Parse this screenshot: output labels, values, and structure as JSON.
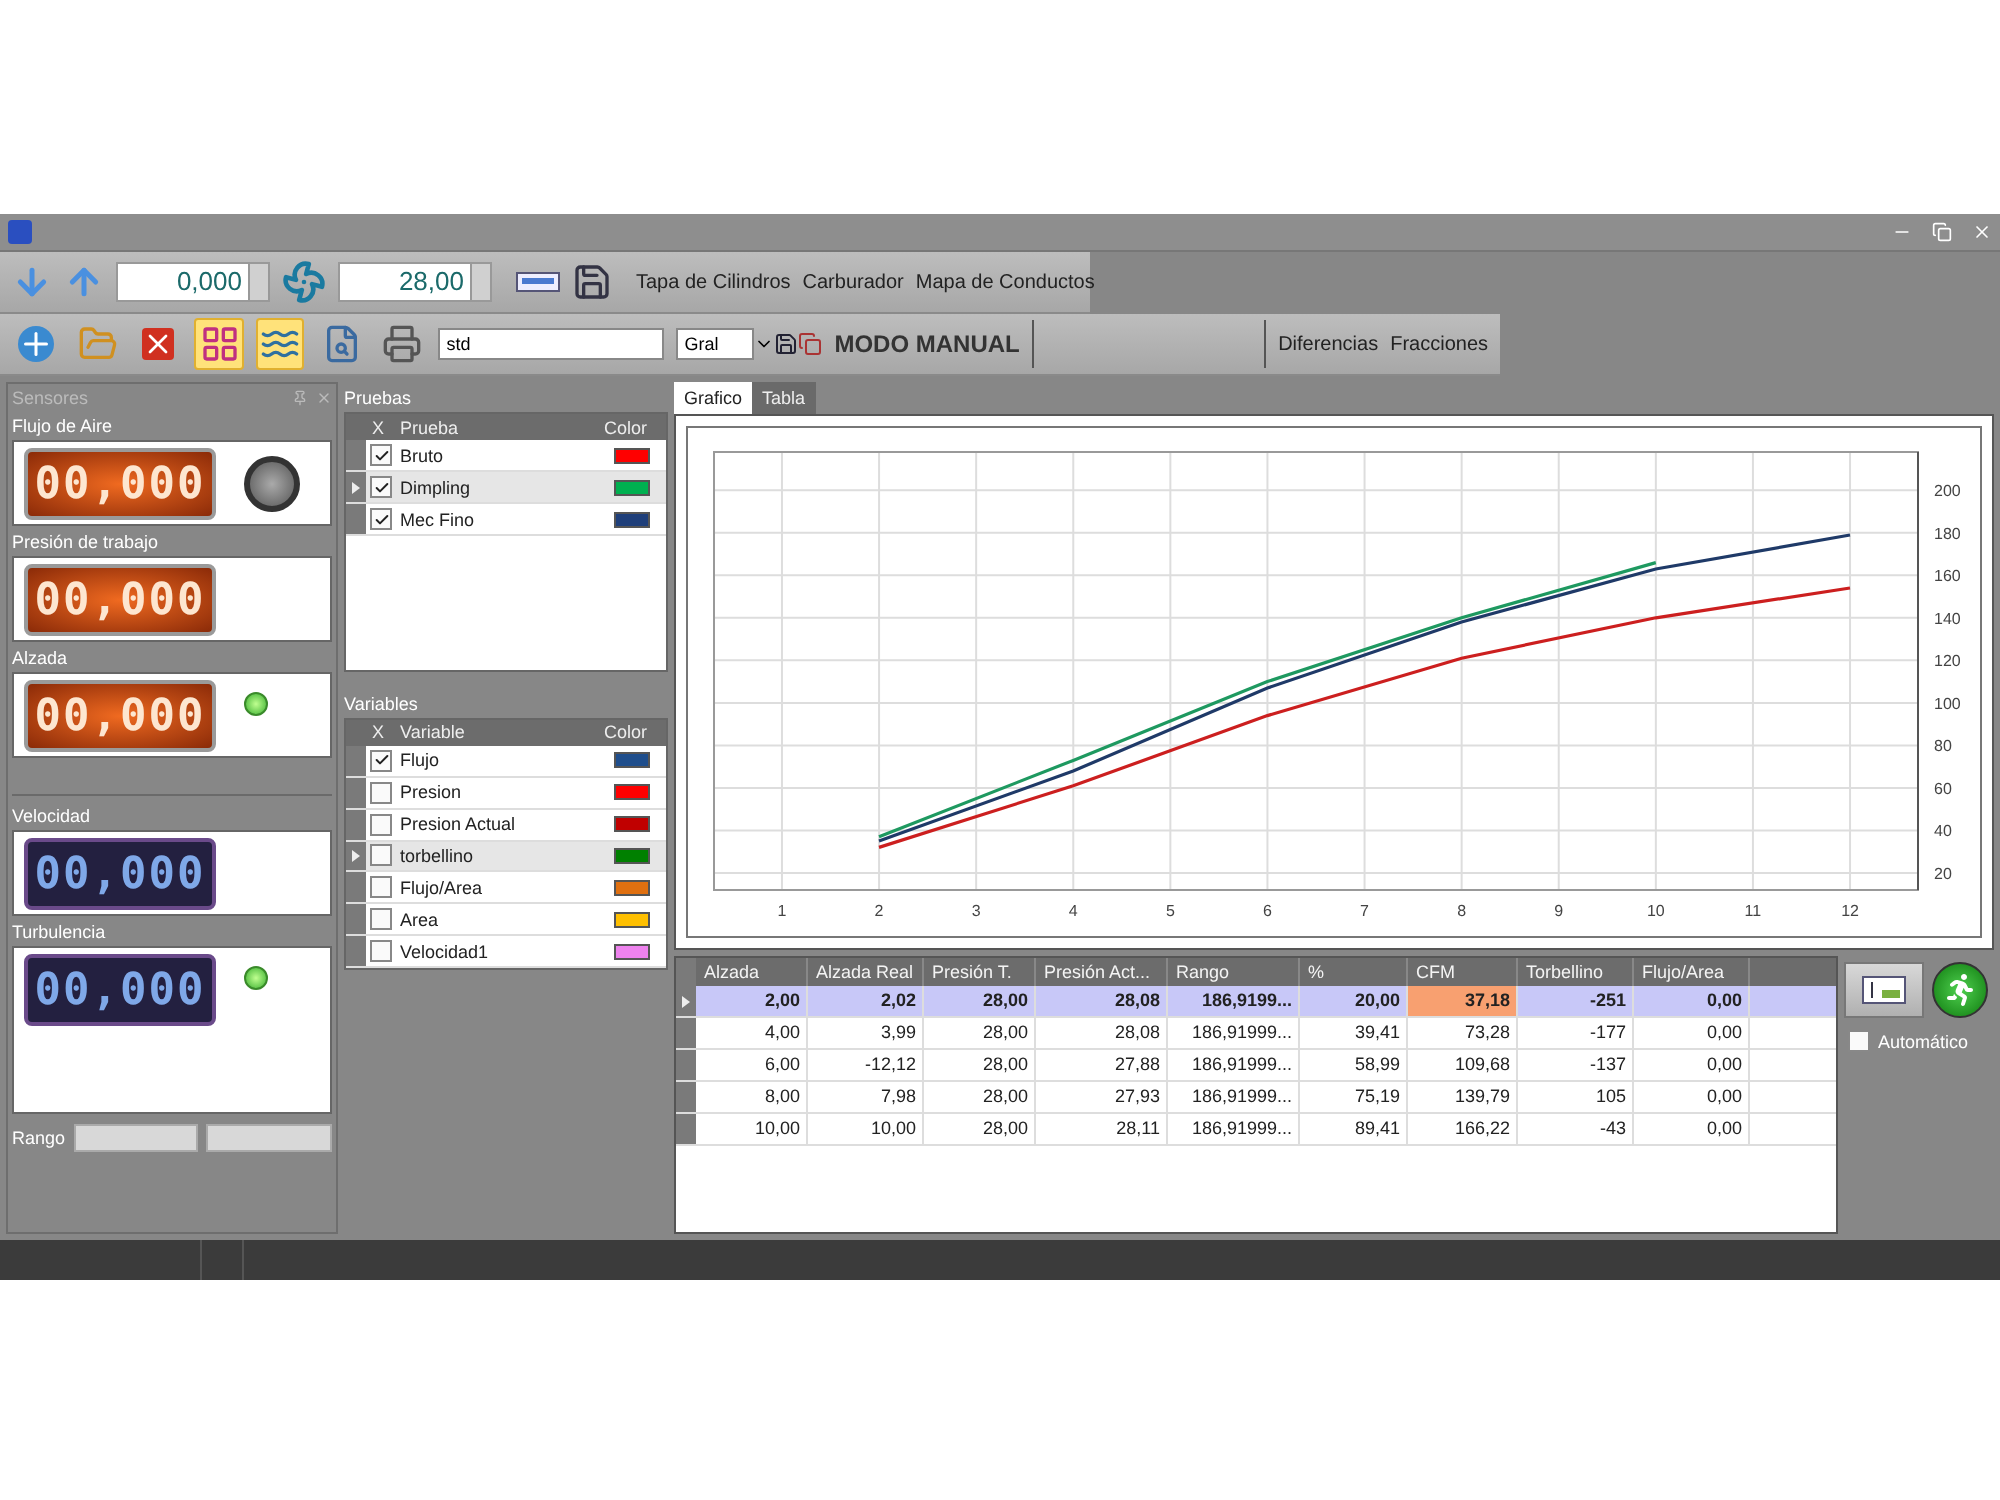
{
  "toolbar_top": {
    "fields": [
      {
        "value": "0,000"
      },
      {
        "value": "28,00"
      }
    ],
    "links": [
      "Tapa de Cilindros",
      "Carburador",
      "Mapa de Conductos"
    ]
  },
  "toolbar_main": {
    "view_buttons": [
      {
        "kind": "grid",
        "selected": true
      },
      {
        "kind": "lines",
        "selected": true
      }
    ],
    "name_field": {
      "value": "std"
    },
    "combo": {
      "value": "Gral"
    },
    "mode_label": "MODO MANUAL",
    "links": [
      "Diferencias",
      "Fracciones"
    ]
  },
  "sensors": {
    "title": "Sensores",
    "range_label": "Rango",
    "items": [
      {
        "label": "Flujo de Aire",
        "reading": "00,000",
        "kind": "orange",
        "light_on": false
      },
      {
        "label": "Presión de trabajo",
        "reading": "00,000",
        "kind": "orange"
      },
      {
        "label": "Alzada",
        "reading": "00,000",
        "kind": "orange",
        "light_on": true
      },
      {
        "label": "Velocidad",
        "reading": "00,000",
        "kind": "blue"
      },
      {
        "label": "Turbulencia",
        "reading": "00,000",
        "kind": "blue",
        "light_on": true
      }
    ]
  },
  "pruebas": {
    "title": "Pruebas",
    "columns": [
      "X",
      "Prueba",
      "Color"
    ],
    "rows": [
      {
        "name": "Bruto",
        "checked": true,
        "selected": false,
        "color": "#ff0000"
      },
      {
        "name": "Dimpling",
        "checked": true,
        "selected": true,
        "color": "#00b050"
      },
      {
        "name": "Mec Fino",
        "checked": true,
        "selected": false,
        "color": "#1f3f7a"
      }
    ]
  },
  "variables": {
    "title": "Variables",
    "columns": [
      "X",
      "Variable",
      "Color"
    ],
    "rows": [
      {
        "name": "Flujo",
        "checked": true,
        "selected": false,
        "color": "#1f4e8c"
      },
      {
        "name": "Presion",
        "checked": false,
        "selected": false,
        "color": "#ff0000"
      },
      {
        "name": "Presion Actual",
        "checked": false,
        "selected": false,
        "color": "#c00000"
      },
      {
        "name": "torbellino",
        "checked": false,
        "selected": true,
        "color": "#008000"
      },
      {
        "name": "Flujo/Area",
        "checked": false,
        "selected": false,
        "color": "#e07010"
      },
      {
        "name": "Area",
        "checked": false,
        "selected": false,
        "color": "#ffc000"
      },
      {
        "name": "Velocidad1",
        "checked": false,
        "selected": false,
        "color": "#ee82ee"
      }
    ]
  },
  "tabs": [
    {
      "label": "Grafico",
      "selected": true
    },
    {
      "label": "Tabla",
      "selected": false
    }
  ],
  "chart_data": {
    "type": "line",
    "grid": true,
    "x": [
      2,
      4,
      6,
      8,
      10,
      12
    ],
    "xlim": [
      0.3,
      12.7
    ],
    "ylim": [
      12,
      218
    ],
    "xticks": [
      1,
      2,
      3,
      4,
      5,
      6,
      7,
      8,
      9,
      10,
      11,
      12
    ],
    "yticks": [
      20,
      40,
      60,
      80,
      100,
      120,
      140,
      160,
      180,
      200
    ],
    "series": [
      {
        "color": "#cc1f1f",
        "values": [
          32,
          61,
          94,
          121,
          140,
          154
        ]
      },
      {
        "color": "#1e9960",
        "values": [
          37,
          73,
          110,
          140,
          166,
          null
        ]
      },
      {
        "color": "#1f3a68",
        "values": [
          35,
          68,
          107,
          138,
          163,
          179
        ]
      }
    ]
  },
  "results": {
    "columns": [
      {
        "label": "Alzada",
        "highlighted": false
      },
      {
        "label": "Alzada Real",
        "highlighted": false
      },
      {
        "label": "Presión T.",
        "highlighted": false
      },
      {
        "label": "Presión Act...",
        "highlighted": false
      },
      {
        "label": "Rango",
        "highlighted": false
      },
      {
        "label": "%",
        "highlighted": false
      },
      {
        "label": "CFM",
        "highlighted": true
      },
      {
        "label": "Torbellino",
        "highlighted": false
      },
      {
        "label": "Flujo/Area",
        "highlighted": false
      }
    ],
    "rows": [
      {
        "selected": true,
        "cells": [
          "2,00",
          "2,02",
          "28,00",
          "28,08",
          "186,9199...",
          "20,00",
          "37,18",
          "-251",
          "0,00"
        ]
      },
      {
        "selected": false,
        "cells": [
          "4,00",
          "3,99",
          "28,00",
          "28,08",
          "186,91999...",
          "39,41",
          "73,28",
          "-177",
          "0,00"
        ]
      },
      {
        "selected": false,
        "cells": [
          "6,00",
          "-12,12",
          "28,00",
          "27,88",
          "186,91999...",
          "58,99",
          "109,68",
          "-137",
          "0,00"
        ]
      },
      {
        "selected": false,
        "cells": [
          "8,00",
          "7,98",
          "28,00",
          "27,93",
          "186,91999...",
          "75,19",
          "139,79",
          "105",
          "0,00"
        ]
      },
      {
        "selected": false,
        "cells": [
          "10,00",
          "10,00",
          "28,00",
          "28,11",
          "186,91999...",
          "89,41",
          "166,22",
          "-43",
          "0,00"
        ]
      }
    ]
  },
  "automatic": {
    "label": "Automático",
    "checked": false
  }
}
